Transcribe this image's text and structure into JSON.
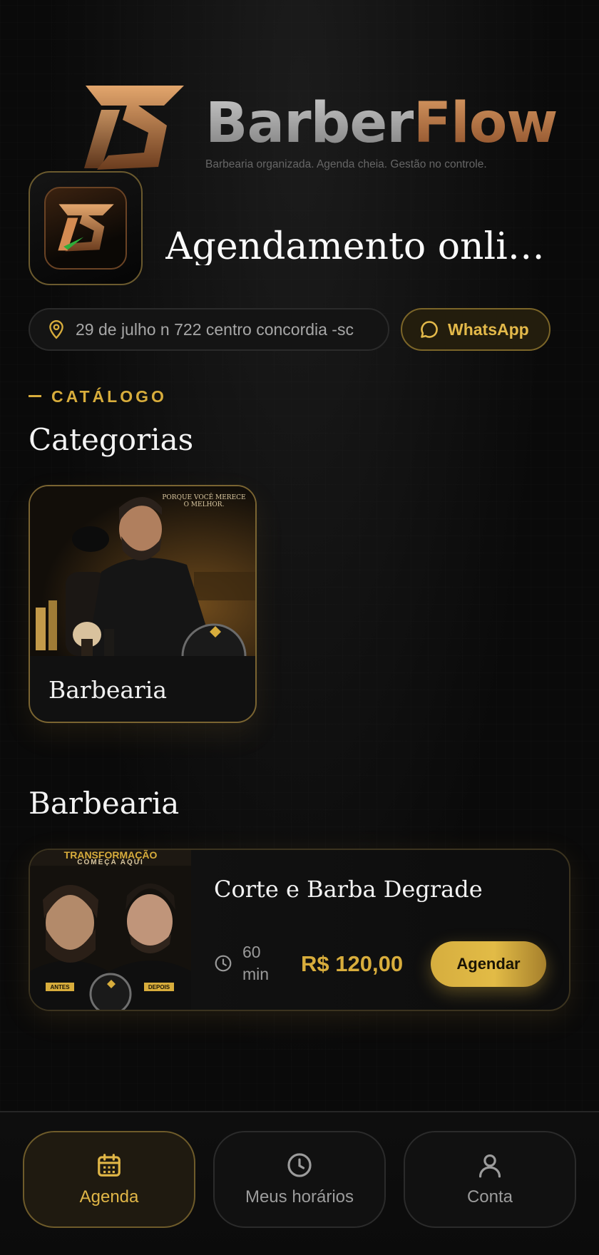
{
  "brand": {
    "name_part1": "Barber",
    "name_part2": "Flow",
    "tagline": "Barbearia organizada. Agenda cheia. Gestão no controle."
  },
  "shop": {
    "title": "Agendamento online ...",
    "address": "29 de julho n 722 centro concordia -sc",
    "whatsapp_label": "WhatsApp"
  },
  "catalog": {
    "eyebrow": "CATÁLOGO",
    "heading": "Categorias",
    "categories": [
      {
        "label": "Barbearia",
        "image_text": "PORQUE VOCÊ MERECE O MELHOR."
      }
    ]
  },
  "services_section": {
    "heading": "Barbearia",
    "services": [
      {
        "title": "Corte e Barba Degrade",
        "duration": "60 min",
        "price": "R$ 120,00",
        "button": "Agendar",
        "image_text": {
          "top1": "TRANSFORMAÇÃO",
          "top2": "COMEÇA AQUI",
          "before": "ANTES",
          "after": "DEPOIS"
        }
      }
    ]
  },
  "nav": {
    "items": [
      {
        "label": "Agenda",
        "icon": "calendar-icon",
        "active": true
      },
      {
        "label": "Meus horários",
        "icon": "clock-icon",
        "active": false
      },
      {
        "label": "Conta",
        "icon": "user-icon",
        "active": false
      }
    ]
  },
  "colors": {
    "accent": "#d8ad3c",
    "background": "#0a0a0a",
    "brand_copper": "#c07a45"
  }
}
